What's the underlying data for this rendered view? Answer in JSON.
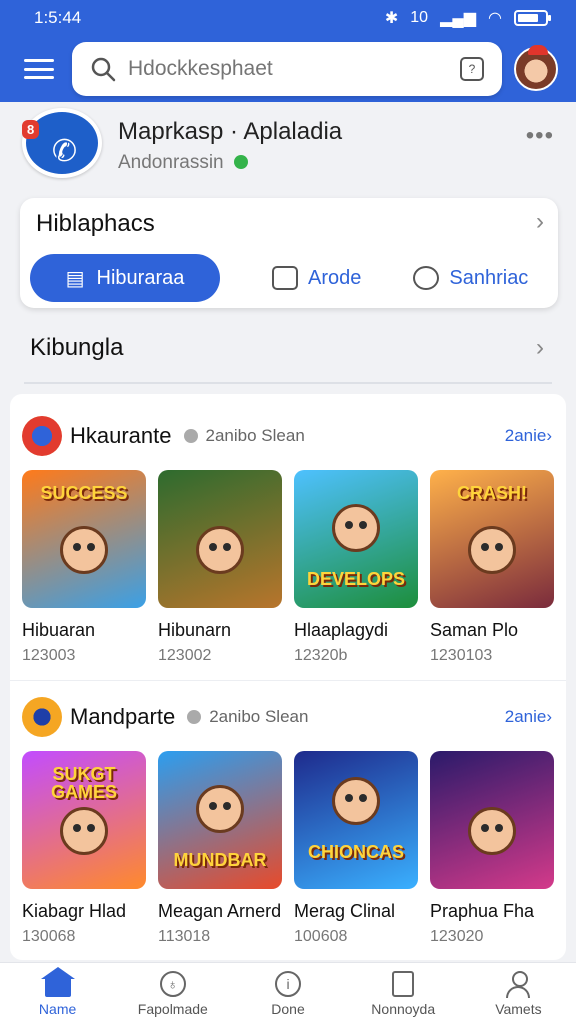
{
  "status": {
    "time": "1:5:44",
    "network": "10"
  },
  "search": {
    "placeholder": "Hdockkesphaet"
  },
  "app": {
    "name": "Maprkasp · Aplaladia",
    "subtitle": "Andonrassin",
    "badge": "8"
  },
  "card": {
    "title": "Hiblaphacs",
    "tabs": [
      {
        "label": "Hiburaraa"
      },
      {
        "label": "Arode"
      },
      {
        "label": "Sanhriac"
      }
    ]
  },
  "section": {
    "title": "Kibungla"
  },
  "groups": [
    {
      "name": "Hkaurante",
      "subtitle": "2anibo Slean",
      "more": "2anie›",
      "items": [
        {
          "name": "Hibuaran",
          "count": "123003",
          "title": "SUCCESS",
          "c1": "#ff7a1a",
          "c2": "#3aa0e6"
        },
        {
          "name": "Hibunarn",
          "count": "123002",
          "title": "",
          "c1": "#2d6b2e",
          "c2": "#b8752c"
        },
        {
          "name": "Hlaaplagydi",
          "count": "12320b",
          "title": "DEVELOPS",
          "c1": "#4ec1ff",
          "c2": "#1d8e3b"
        },
        {
          "name": "Saman Plo",
          "count": "1230103",
          "title": "CRASH!",
          "c1": "#ffb14a",
          "c2": "#7a2b3c"
        }
      ]
    },
    {
      "name": "Mandparte",
      "subtitle": "2anibo Slean",
      "more": "2anie›",
      "items": [
        {
          "name": "Kiabagr Hlad",
          "count": "130068",
          "title": "SUKGT GAMES",
          "c1": "#c24cff",
          "c2": "#ff8a2b"
        },
        {
          "name": "Meagan Arnerd",
          "count": "113018",
          "title": "MUNDBAR",
          "c1": "#2b9ef0",
          "c2": "#e84a2a"
        },
        {
          "name": "Merag Clinal",
          "count": "100608",
          "title": "CHIONCAS",
          "c1": "#1e2a8c",
          "c2": "#3ab0ff"
        },
        {
          "name": "Praphua Fha",
          "count": "123020",
          "title": "",
          "c1": "#2a1a6a",
          "c2": "#d43a8a"
        }
      ]
    }
  ],
  "nav": [
    {
      "label": "Name"
    },
    {
      "label": "Fapolmade"
    },
    {
      "label": "Done"
    },
    {
      "label": "Nonnoyda"
    },
    {
      "label": "Vamets"
    }
  ],
  "colors": {
    "accent": "#2f63d9",
    "header": "#2f63d9"
  }
}
